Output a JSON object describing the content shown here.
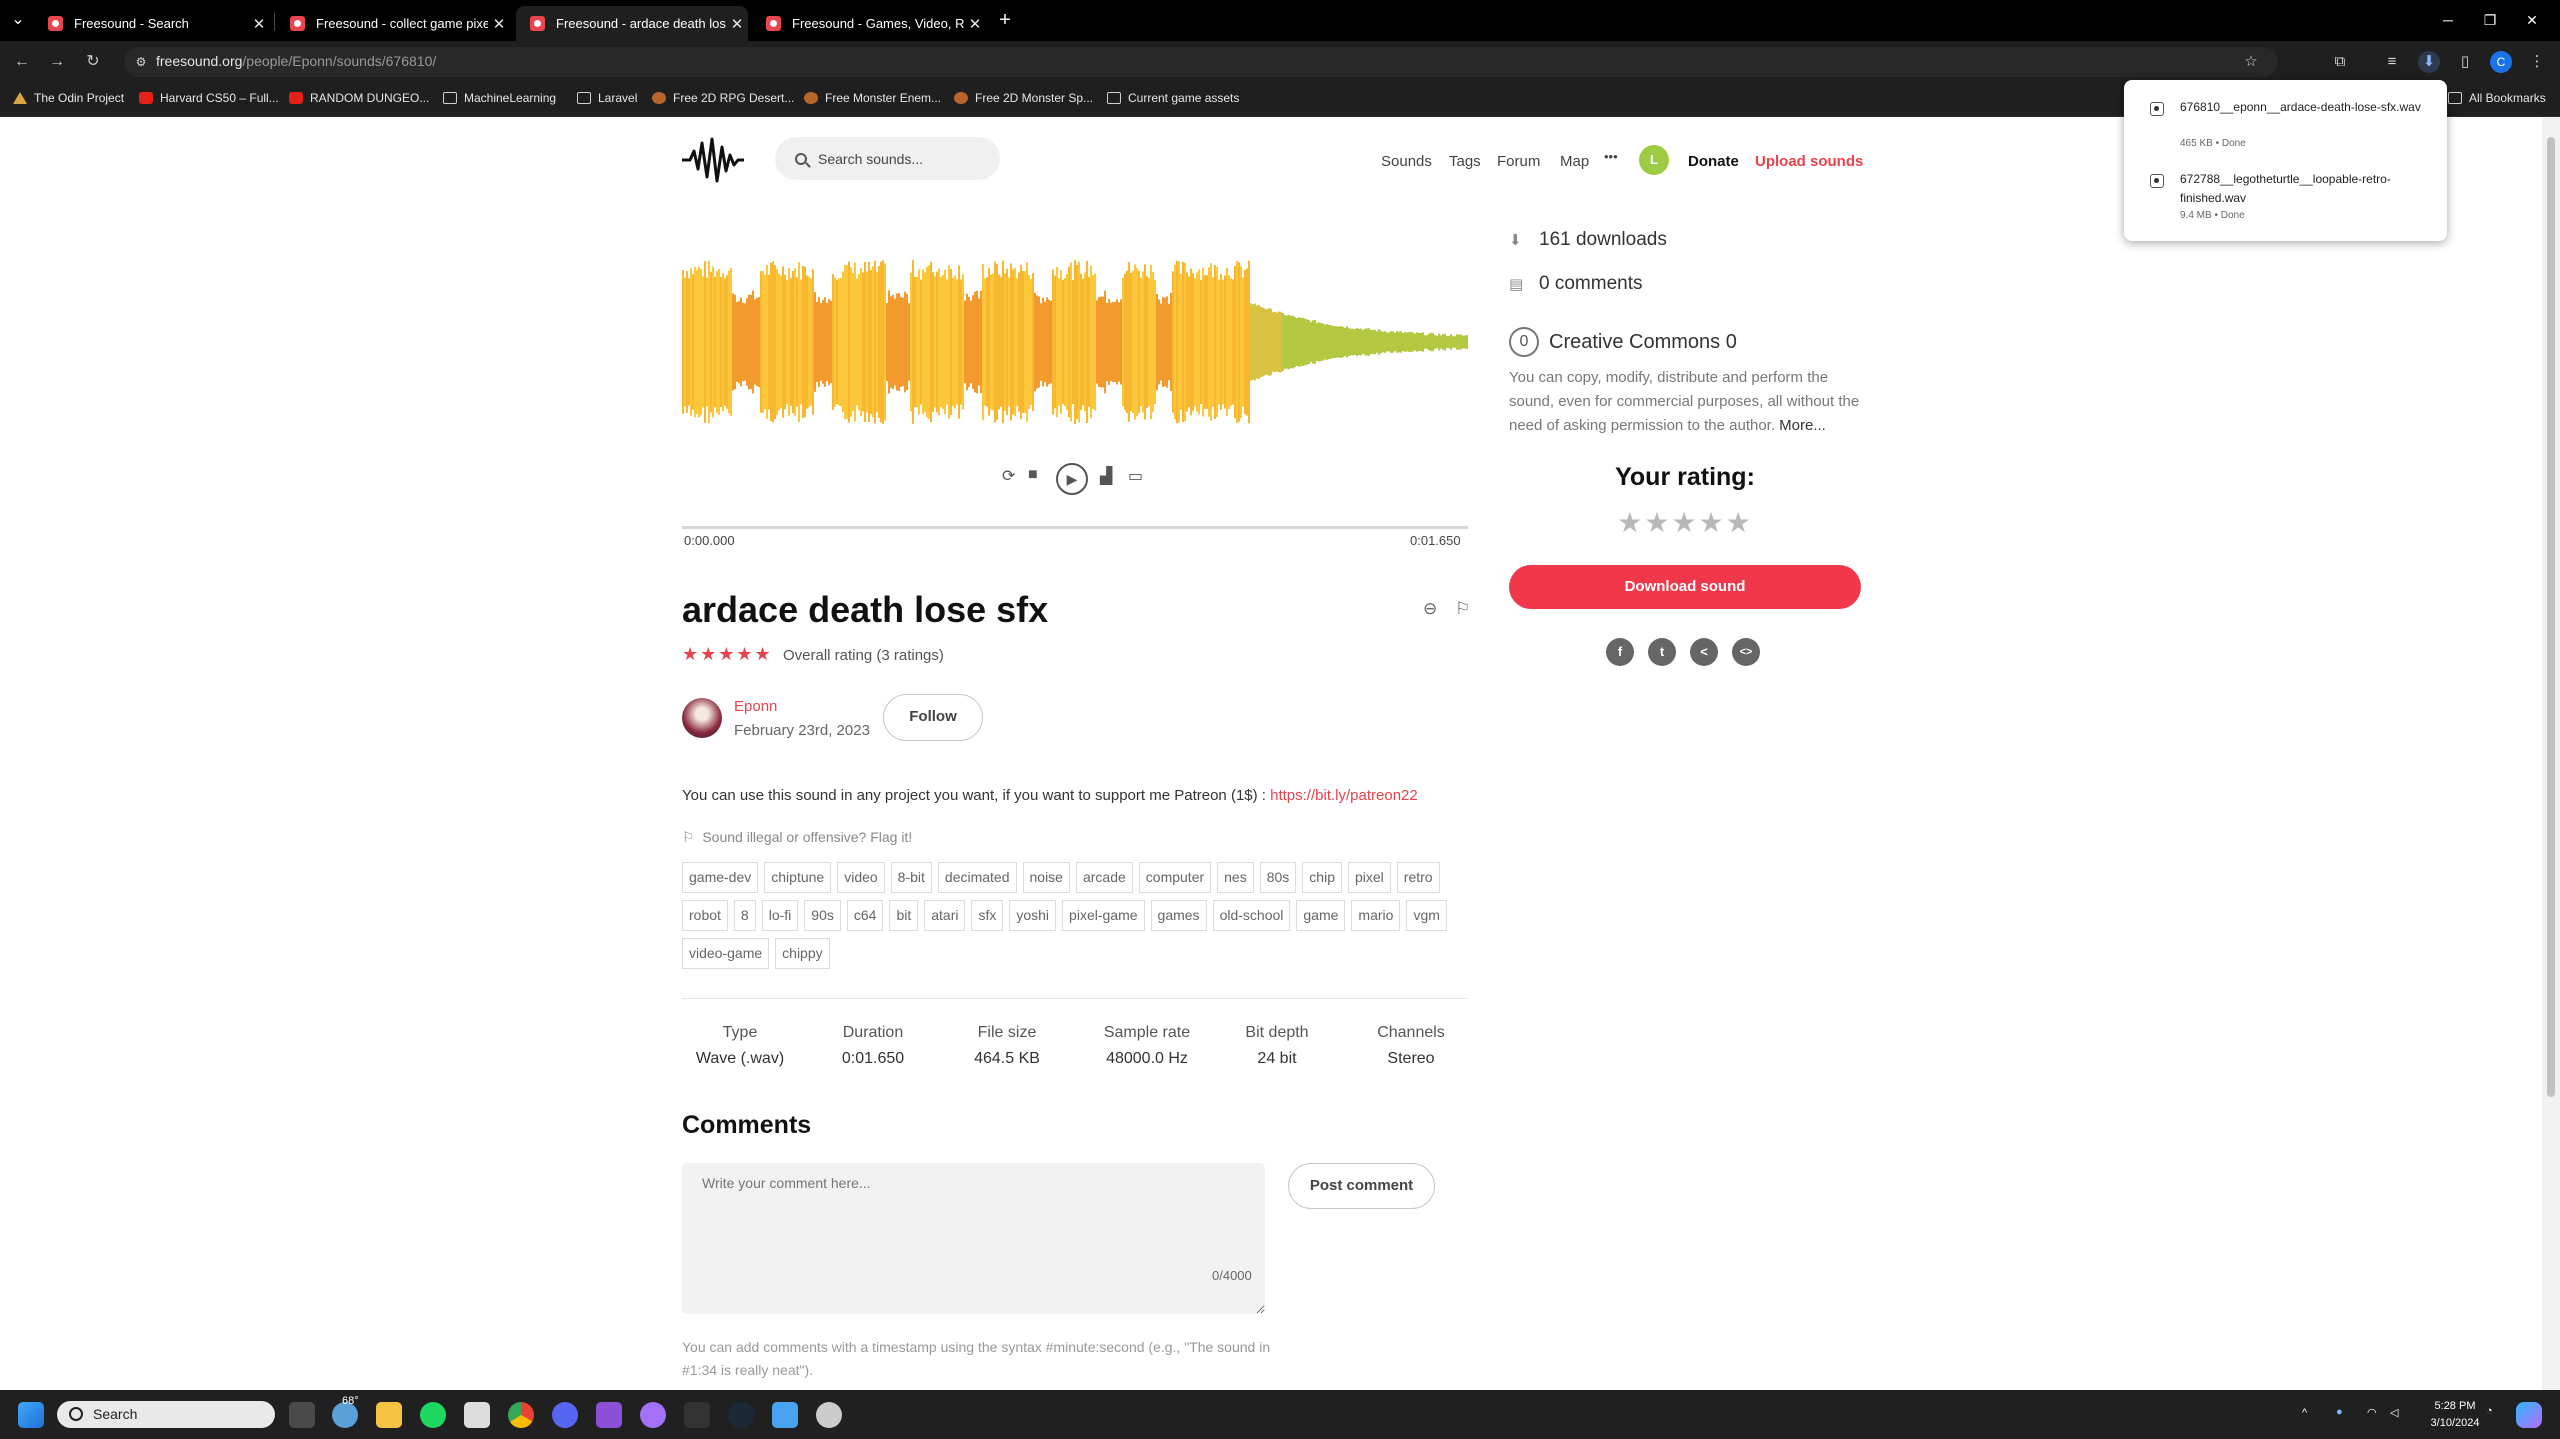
{
  "browser": {
    "tabs": [
      {
        "title": "Freesound - Search",
        "active": false
      },
      {
        "title": "Freesound - collect game pixel",
        "active": false
      },
      {
        "title": "Freesound - ardace death lose",
        "active": true
      },
      {
        "title": "Freesound - Games, Video, Retr",
        "active": false
      }
    ],
    "new_tab": "+",
    "url_host": "freesound.org",
    "url_path": "/people/Eponn/sounds/676810/",
    "bookmarks": [
      {
        "label": "The Odin Project",
        "icon": "odin-icon"
      },
      {
        "label": "Harvard CS50 – Full...",
        "icon": "youtube-icon"
      },
      {
        "label": "RANDOM DUNGEO...",
        "icon": "youtube-icon"
      },
      {
        "label": "MachineLearning",
        "icon": "folder-icon"
      },
      {
        "label": "Laravel",
        "icon": "folder-icon"
      },
      {
        "label": "Free 2D RPG Desert...",
        "icon": "itch-icon"
      },
      {
        "label": "Free Monster Enem...",
        "icon": "itch-icon"
      },
      {
        "label": "Free 2D Monster Sp...",
        "icon": "itch-icon"
      },
      {
        "label": "Current game assets",
        "icon": "folder-icon"
      }
    ],
    "all_bookmarks": "All Bookmarks",
    "profile_initial": "C"
  },
  "downloads": [
    {
      "name": "676810__eponn__ardace-death-lose-sfx.wav",
      "status": "465 KB • Done"
    },
    {
      "name": "672788__legotheturtle__loopable-retro-finished.wav",
      "status": "9.4 MB • Done"
    }
  ],
  "site": {
    "search_placeholder": "Search sounds...",
    "nav": {
      "sounds": "Sounds",
      "tags": "Tags",
      "forum": "Forum",
      "map": "Map",
      "more": "•••",
      "donate": "Donate",
      "upload": "Upload sounds"
    },
    "user_initial": "L"
  },
  "player": {
    "time_start": "0:00.000",
    "time_end": "0:01.650",
    "progress": 0
  },
  "sound": {
    "title": "ardace death lose sfx",
    "stars": "★★★★★",
    "rating_text": "Overall rating (3 ratings)",
    "author": "Eponn",
    "date": "February 23rd, 2023",
    "follow": "Follow",
    "description": "You can use this sound in any project you want, if you want to support me Patreon (1$) : ",
    "description_link": "https://bit.ly/patreon22",
    "flag": "Sound illegal or offensive? Flag it!",
    "tags": [
      "game-dev",
      "chiptune",
      "video",
      "8-bit",
      "decimated",
      "noise",
      "arcade",
      "computer",
      "nes",
      "80s",
      "chip",
      "pixel",
      "retro",
      "robot",
      "8",
      "lo-fi",
      "90s",
      "c64",
      "bit",
      "atari",
      "sfx",
      "yoshi",
      "pixel-game",
      "games",
      "old-school",
      "game",
      "mario",
      "vgm",
      "video-game",
      "chippy"
    ],
    "meta": [
      {
        "key": "Type",
        "value": "Wave (.wav)"
      },
      {
        "key": "Duration",
        "value": "0:01.650"
      },
      {
        "key": "File size",
        "value": "464.5 KB"
      },
      {
        "key": "Sample rate",
        "value": "48000.0 Hz"
      },
      {
        "key": "Bit depth",
        "value": "24 bit"
      },
      {
        "key": "Channels",
        "value": "Stereo"
      }
    ]
  },
  "comments": {
    "heading": "Comments",
    "placeholder": "Write your comment here...",
    "count": "0/4000",
    "post": "Post comment",
    "hint": "You can add comments with a timestamp using the syntax #minute:second (e.g., \"The sound in #1:34 is really neat\")."
  },
  "sidebar": {
    "downloads": "161 downloads",
    "comments": "0 comments",
    "license_badge": "0",
    "license": "Creative Commons 0",
    "license_text": "You can copy, modify, distribute and perform the sound, even for commercial purposes, all without the need of asking permission to the author. ",
    "license_more": "More...",
    "your_rating": "Your rating:",
    "rating_stars": "★★★★★",
    "download_btn": "Download sound"
  },
  "taskbar": {
    "search": "Search",
    "weather": "68°",
    "time": "5:28 PM",
    "date": "3/10/2024"
  },
  "colors": {
    "accent": "#e8424c",
    "download_btn": "#f0384a",
    "waveform_peak": "#f7b731",
    "waveform_tail": "#b5c842"
  }
}
